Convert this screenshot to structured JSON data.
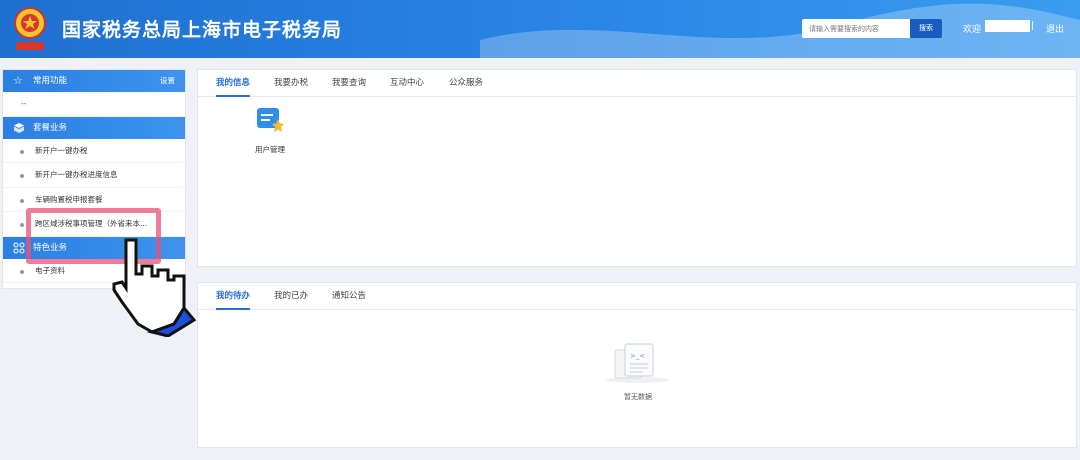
{
  "header": {
    "title": "国家税务总局上海市电子税务局",
    "search_placeholder": "请输入需要搜索的内容",
    "search_button": "搜索",
    "welcome": "欢迎",
    "separator": "|",
    "logout": "退出",
    "emblem_icon": "tax-emblem-icon"
  },
  "sidebar": {
    "sections": [
      {
        "title": "常用功能",
        "icon": "star-icon",
        "setting": "设置"
      },
      {
        "title": "套餐业务",
        "icon": "cube-icon"
      },
      {
        "title": "特色业务",
        "icon": "grid-icon"
      }
    ],
    "common_placeholder": "--",
    "package_items": [
      "新开户一键办税",
      "新开户一键办税进度信息",
      "车辆购置税申报套餐",
      "跨区域涉税事项管理（外省来本..."
    ],
    "special_items": [
      "电子资料"
    ]
  },
  "top_panel": {
    "tabs": [
      "我的信息",
      "我要办税",
      "我要查询",
      "互动中心",
      "公众服务"
    ],
    "active_tab": 0,
    "apps": [
      {
        "label": "用户管理",
        "icon": "user-management-icon"
      }
    ]
  },
  "bottom_panel": {
    "tabs": [
      "我的待办",
      "我的已办",
      "通知公告"
    ],
    "active_tab": 0,
    "empty_text": "暂无数据",
    "empty_icon": "empty-document-icon"
  },
  "colors": {
    "header_blue": "#2a86e6",
    "active_tab": "#2b6fd6",
    "highlight": "#ec5078"
  }
}
